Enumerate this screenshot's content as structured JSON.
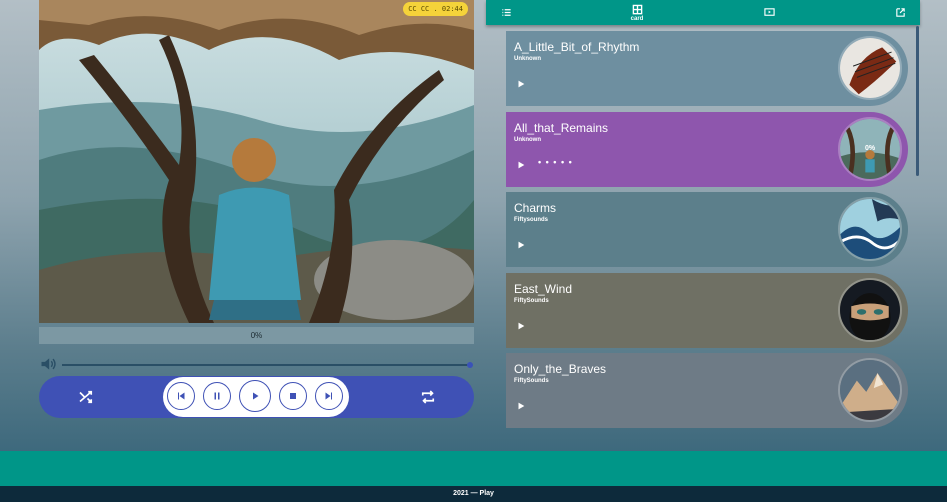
{
  "player": {
    "time_badge": "CC CC . 02:44",
    "progress": {
      "value": 0,
      "label": "0%"
    },
    "volume": {
      "level": 1.0
    }
  },
  "nav": {
    "items": [
      {
        "icon": "list-icon",
        "label": ""
      },
      {
        "icon": "card-icon",
        "label": "card"
      },
      {
        "icon": "video-icon",
        "label": ""
      },
      {
        "icon": "open-external-icon",
        "label": ""
      }
    ]
  },
  "playlist": [
    {
      "title": "A_Little_Bit_of_Rhythm",
      "artist": "Unknown",
      "color": "#6e8fa0",
      "active": false
    },
    {
      "title": "All_that_Remains",
      "artist": "Unknown",
      "color": "#8e56ad",
      "active": true,
      "percent": "0%",
      "dots": "• • • • •"
    },
    {
      "title": "Charms",
      "artist": "Fiftysounds",
      "color": "#5c7f8b",
      "active": false
    },
    {
      "title": "East_Wind",
      "artist": "FiftySounds",
      "color": "#6f7064",
      "active": false
    },
    {
      "title": "Only_the_Braves",
      "artist": "FiftySounds",
      "color": "#6e7b86",
      "active": false
    }
  ],
  "footer": {
    "text": "2021 — Play"
  },
  "colors": {
    "accent": "#009688",
    "controls": "#3f51b5",
    "badge": "#f5d33a"
  }
}
